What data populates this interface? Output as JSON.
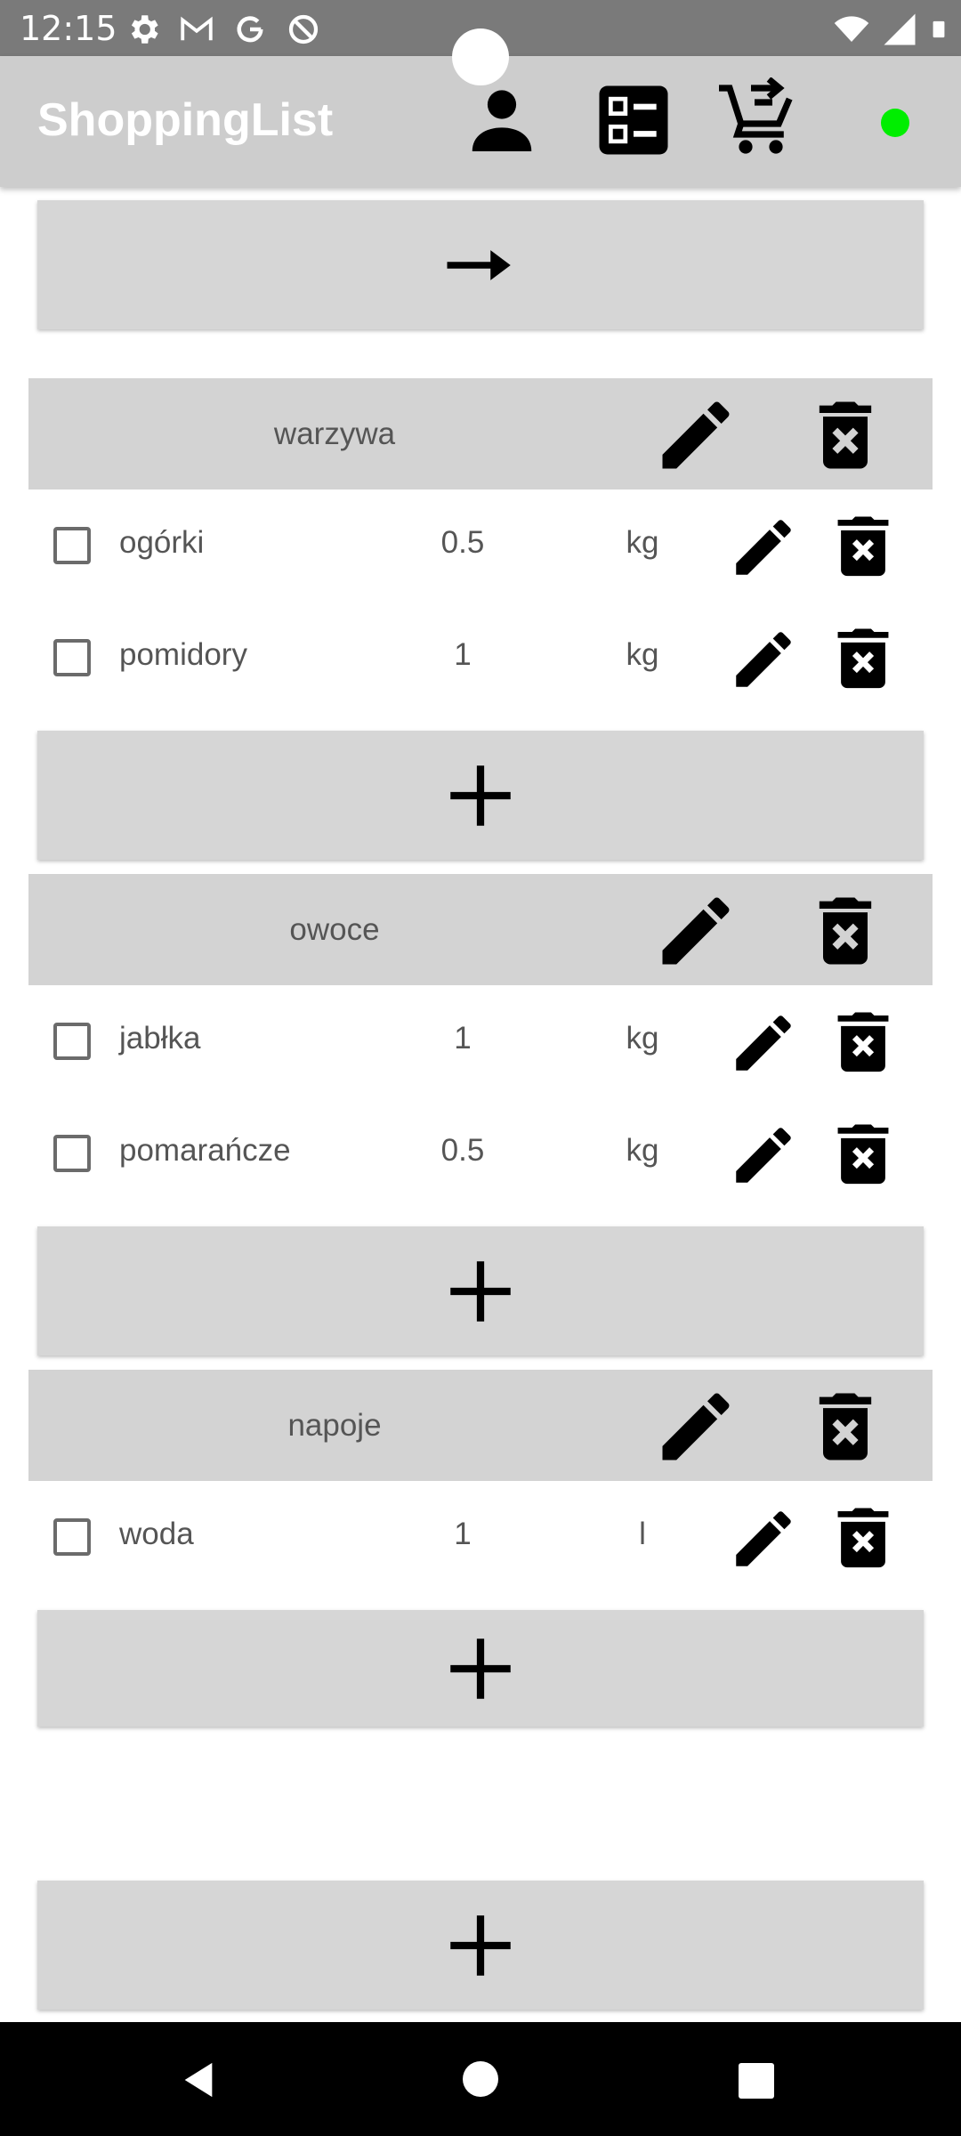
{
  "status_bar": {
    "time": "12:15",
    "left_icons": [
      "settings-icon",
      "gmail-icon",
      "google-icon",
      "data-saver-icon"
    ],
    "right_icons": [
      "wifi-icon",
      "signal-icon",
      "battery-icon"
    ]
  },
  "app_bar": {
    "title": "ShoppingList",
    "icons": [
      "account-icon",
      "list-view-icon",
      "add-to-cart-icon"
    ],
    "connection_status_color": "#00ee00"
  },
  "top_button": {
    "icon": "arrow-right-icon"
  },
  "categories": [
    {
      "name": "warzywa",
      "items": [
        {
          "name": "ogórki",
          "quantity": "0.5",
          "unit": "kg",
          "checked": false
        },
        {
          "name": "pomidory",
          "quantity": "1",
          "unit": "kg",
          "checked": false
        }
      ],
      "add_item_icon": "plus-icon"
    },
    {
      "name": "owoce",
      "items": [
        {
          "name": "jabłka",
          "quantity": "1",
          "unit": "kg",
          "checked": false
        },
        {
          "name": "pomarańcze",
          "quantity": "0.5",
          "unit": "kg",
          "checked": false
        }
      ],
      "add_item_icon": "plus-icon"
    },
    {
      "name": "napoje",
      "items": [
        {
          "name": "woda",
          "quantity": "1",
          "unit": "l",
          "checked": false
        }
      ],
      "add_item_icon": "plus-icon"
    }
  ],
  "add_category_button": {
    "icon": "plus-icon"
  },
  "nav_bar": {
    "icons": [
      "back-icon",
      "home-icon",
      "recents-icon"
    ]
  },
  "colors": {
    "app_bar": "#cdcdcd",
    "button_bg": "#d6d6d6",
    "category_bg": "#d3d3d3",
    "status_bar": "#7a7a7a"
  }
}
